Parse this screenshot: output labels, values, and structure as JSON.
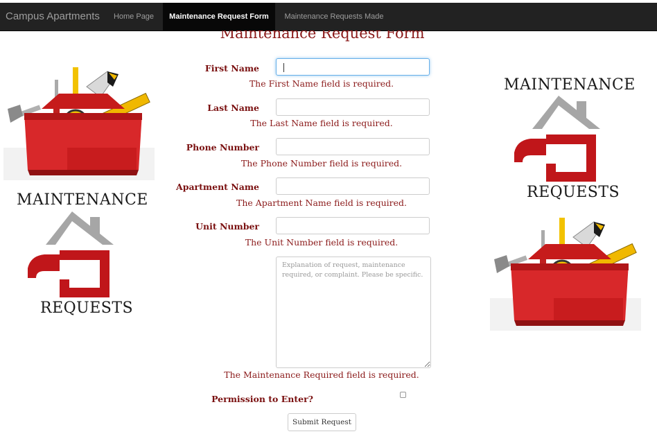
{
  "navbar": {
    "brand": "Campus Apartments",
    "items": [
      {
        "label": "Home Page"
      },
      {
        "label": "Maintenance Request Form"
      },
      {
        "label": "Maintenance Requests Made"
      }
    ]
  },
  "page": {
    "title": "Maintenance Request Form"
  },
  "form": {
    "fields": [
      {
        "label": "First Name",
        "error": "The First Name field is required.",
        "value": ""
      },
      {
        "label": "Last Name",
        "error": "The Last Name field is required.",
        "value": ""
      },
      {
        "label": "Phone Number",
        "error": "The Phone Number field is required.",
        "value": ""
      },
      {
        "label": "Apartment Name",
        "error": "The Apartment Name field is required.",
        "value": ""
      },
      {
        "label": "Unit Number",
        "error": "The Unit Number field is required.",
        "value": ""
      }
    ],
    "maintenance": {
      "placeholder": "Explanation of request, maintenance required, or complaint. Please be specific.",
      "error": "The Maintenance Required field is required."
    },
    "permission_label": "Permission to Enter?",
    "permission_checked": false,
    "submit_label": "Submit Request"
  },
  "logos": {
    "top_word": "MAINTENANCE",
    "bottom_word": "REQUESTS"
  },
  "colors": {
    "navbar_bg": "#222222",
    "active_nav_bg": "#080808",
    "label_red": "#7a1010",
    "logo_red": "#c0161a",
    "logo_gray": "#a6a6a6"
  },
  "icons": [
    "toolbox-icon",
    "house-logo-icon"
  ]
}
